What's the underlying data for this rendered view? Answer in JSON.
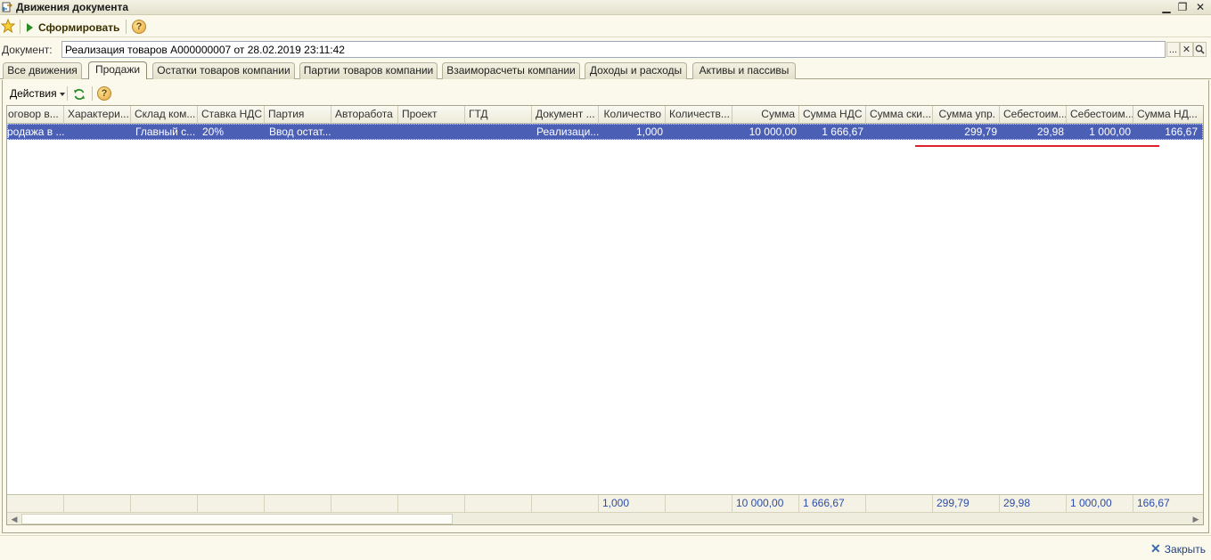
{
  "window": {
    "title": "Движения документа",
    "minimize_glyph": "▁",
    "restore_glyph": "❐",
    "close_glyph": "✕"
  },
  "toolbar": {
    "generate_label": "Сформировать",
    "help_glyph": "?"
  },
  "document": {
    "label": "Документ:",
    "value": "Реализация товаров А000000007 от 28.02.2019 23:11:42",
    "select_glyph": "...",
    "clear_glyph": "✕",
    "open_glyph": "🔍"
  },
  "tabs": [
    {
      "label": "Все движения"
    },
    {
      "label": "Продажи"
    },
    {
      "label": "Остатки товаров компании"
    },
    {
      "label": "Партии товаров компании"
    },
    {
      "label": "Взаиморасчеты компании"
    },
    {
      "label": "Доходы и расходы"
    },
    {
      "label": "Активы и пассивы"
    }
  ],
  "actions": {
    "label": "Действия",
    "help_glyph": "?"
  },
  "grid": {
    "columns": [
      {
        "label": "оговор в..."
      },
      {
        "label": "Характери..."
      },
      {
        "label": "Склад ком..."
      },
      {
        "label": "Ставка НДС"
      },
      {
        "label": "Партия"
      },
      {
        "label": "Авторабота"
      },
      {
        "label": "Проект"
      },
      {
        "label": "ГТД"
      },
      {
        "label": "Документ ..."
      },
      {
        "label": "Количество"
      },
      {
        "label": "Количеств..."
      },
      {
        "label": "Сумма"
      },
      {
        "label": "Сумма НДС"
      },
      {
        "label": "Сумма ски..."
      },
      {
        "label": "Сумма упр."
      },
      {
        "label": "Себестоим..."
      },
      {
        "label": "Себестоим..."
      },
      {
        "label": "Сумма НД..."
      }
    ],
    "row": [
      "родажа в ...",
      "",
      "Главный с...",
      "20%",
      "Ввод остат...",
      "",
      "",
      "",
      "Реализаци...",
      "1,000",
      "",
      "10 000,00",
      "1 666,67",
      "",
      "299,79",
      "29,98",
      "1 000,00",
      "166,67"
    ],
    "totals": [
      "",
      "",
      "",
      "",
      "",
      "",
      "",
      "",
      "",
      "1,000",
      "",
      "10 000,00",
      "1 666,67",
      "",
      "299,79",
      "29,98",
      "1 000,00",
      "166,67"
    ]
  },
  "bottom": {
    "close_label": "Закрыть"
  },
  "colors": {
    "selection": "#4b5fb5",
    "highlight_line": "#e0202a",
    "totals_text": "#2e4da8"
  }
}
